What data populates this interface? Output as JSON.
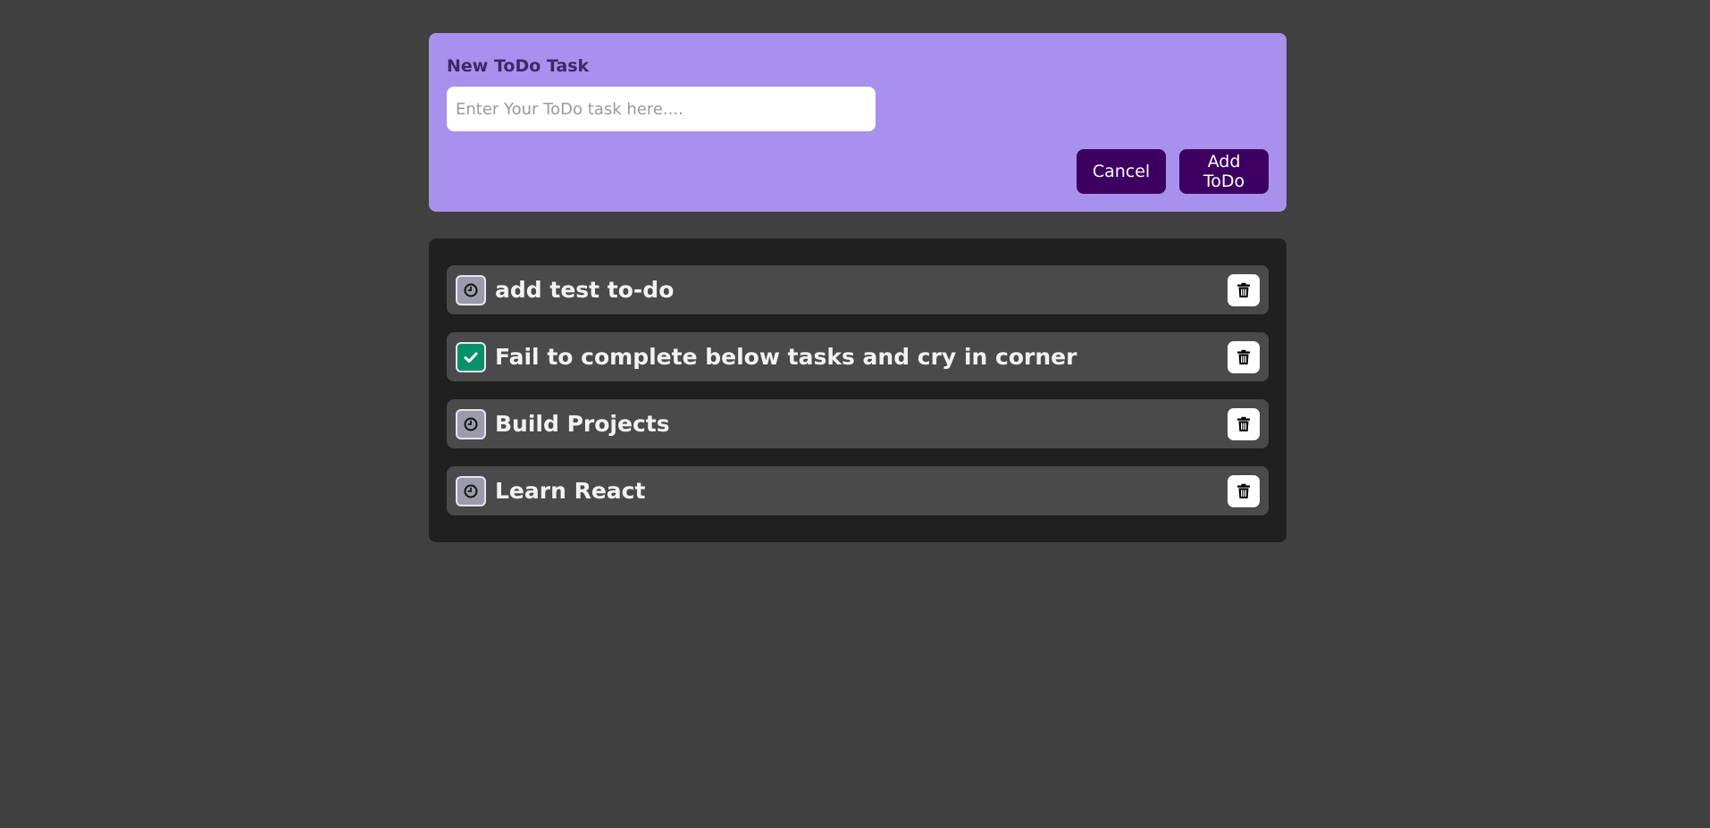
{
  "new_todo": {
    "title": "New ToDo Task",
    "input_value": "",
    "input_placeholder": "Enter Your ToDo task here....",
    "cancel_label": "Cancel",
    "add_label": "Add ToDo"
  },
  "todos": [
    {
      "text": "add test to-do",
      "status": "pending",
      "status_icon": "clock-icon"
    },
    {
      "text": "Fail to complete below tasks and cry in corner",
      "status": "done",
      "status_icon": "check-icon"
    },
    {
      "text": "Build Projects",
      "status": "pending",
      "status_icon": "clock-icon"
    },
    {
      "text": "Learn React",
      "status": "pending",
      "status_icon": "clock-icon"
    }
  ],
  "colors": {
    "page_bg": "#404040",
    "form_bg": "#a891ec",
    "button_bg": "#3d0060",
    "list_bg": "#202020",
    "item_bg": "#4a4a4a",
    "done_green": "#06916b"
  }
}
